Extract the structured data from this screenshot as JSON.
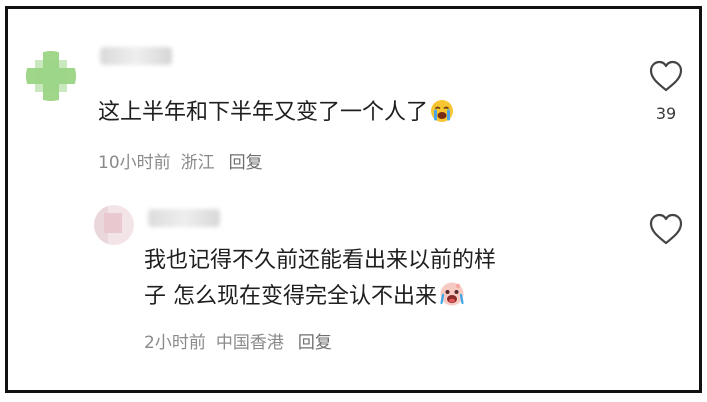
{
  "comment": {
    "text": "这上半年和下半年又变了一个人了",
    "emoji": "loudly-crying-emoji",
    "time": "10小时前",
    "location": "浙江",
    "reply_label": "回复",
    "like_count": "39"
  },
  "reply": {
    "text_line1": "我也记得不久前还能看出来以前的样",
    "text_line2": "子 怎么现在变得完全认不出来",
    "emoji": "crying-face-emoji",
    "time": "2小时前",
    "location": "中国香港",
    "reply_label": "回复"
  },
  "colors": {
    "avatar_green": "#6cc04a",
    "avatar_pink": "#f3e4e7",
    "meta_gray": "#8a8a8a"
  }
}
